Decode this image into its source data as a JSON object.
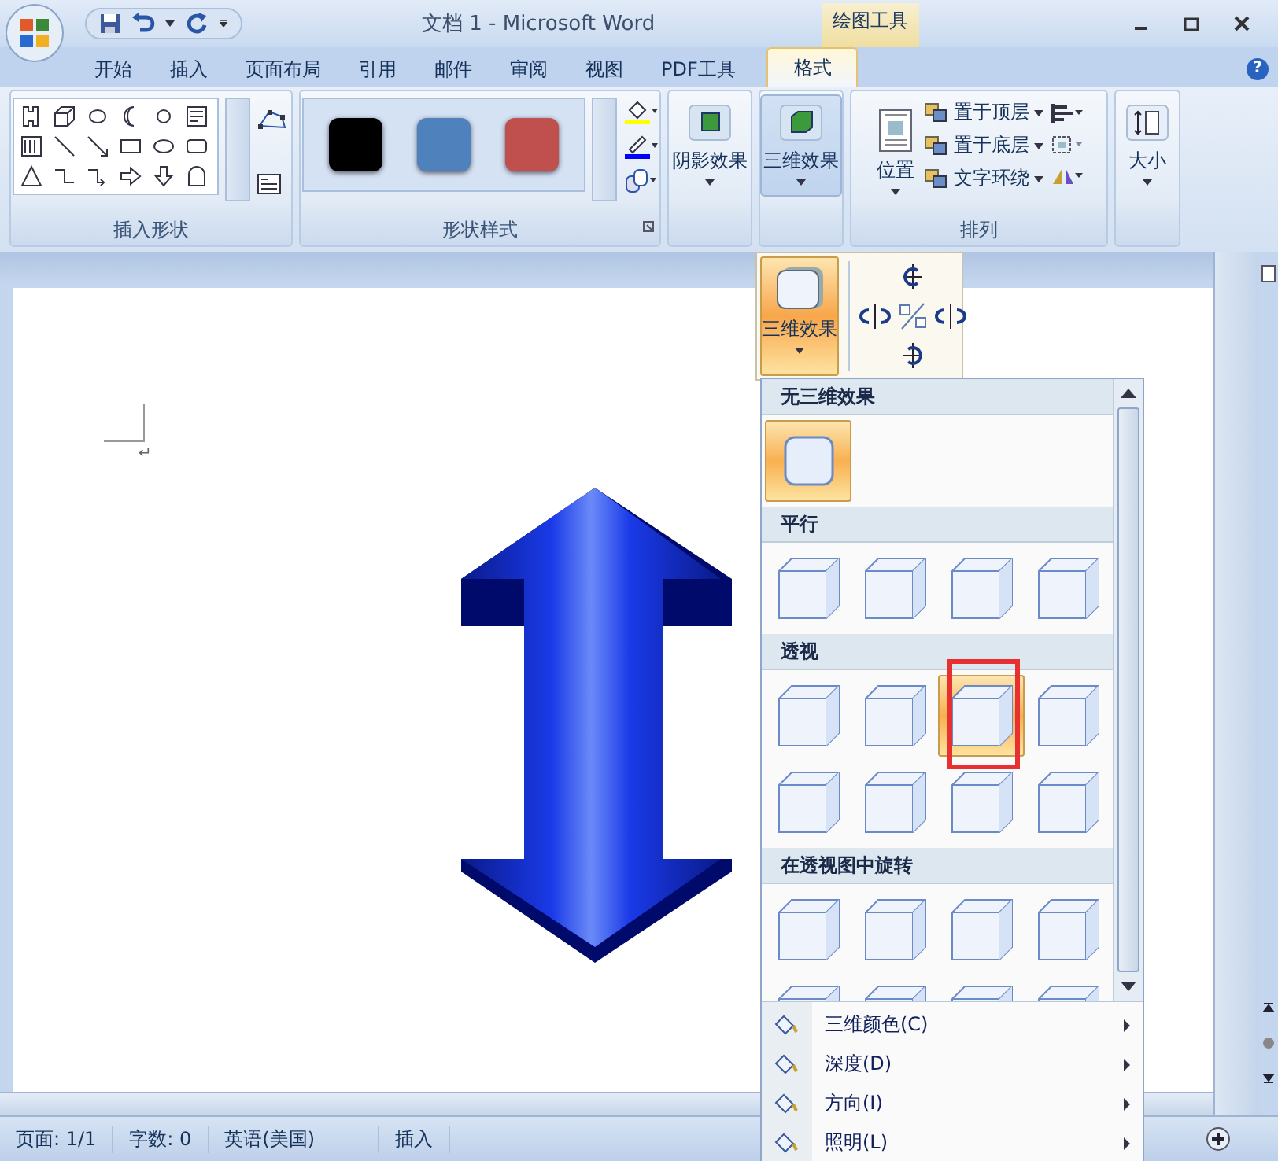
{
  "title_bar": {
    "title": "文档 1 - Microsoft Word",
    "context_tab": "绘图工具"
  },
  "tabs": [
    {
      "label": "开始",
      "selected": false
    },
    {
      "label": "插入",
      "selected": false
    },
    {
      "label": "页面布局",
      "selected": false
    },
    {
      "label": "引用",
      "selected": false
    },
    {
      "label": "邮件",
      "selected": false
    },
    {
      "label": "审阅",
      "selected": false
    },
    {
      "label": "视图",
      "selected": false
    },
    {
      "label": "PDF工具",
      "selected": false
    },
    {
      "label": "格式",
      "selected": true
    }
  ],
  "help": "?",
  "ribbon": {
    "insert_shapes": {
      "label": "插入形状"
    },
    "shape_styles": {
      "label": "形状样式",
      "swatches": [
        {
          "color": "#000000"
        },
        {
          "color": "#4f81bd"
        },
        {
          "color": "#c0504d"
        }
      ]
    },
    "shadow_effects": {
      "label": "阴影效果",
      "pressed": false
    },
    "three_d_effects": {
      "label": "三维效果",
      "pressed": true
    },
    "arrange": {
      "label": "排列",
      "position": "位置",
      "commands": [
        "置于顶层",
        "置于底层",
        "文字环绕"
      ]
    },
    "size": {
      "label": "大小"
    }
  },
  "three_d_flyout": {
    "button": "三维效果"
  },
  "gallery": {
    "sections": [
      {
        "title": "无三维效果",
        "items": [
          {
            "kind": "flat",
            "highlighted": true,
            "marked": false
          }
        ]
      },
      {
        "title": "平行",
        "items": [
          {
            "kind": "cube",
            "highlighted": false,
            "marked": false
          },
          {
            "kind": "cube",
            "highlighted": false,
            "marked": false
          },
          {
            "kind": "cube",
            "highlighted": false,
            "marked": false
          },
          {
            "kind": "cube",
            "highlighted": false,
            "marked": false
          }
        ]
      },
      {
        "title": "透视",
        "items": [
          {
            "kind": "cube",
            "highlighted": false,
            "marked": false
          },
          {
            "kind": "cube",
            "highlighted": false,
            "marked": false
          },
          {
            "kind": "cube",
            "highlighted": true,
            "marked": true
          },
          {
            "kind": "cube",
            "highlighted": false,
            "marked": false
          },
          {
            "kind": "cube",
            "highlighted": false,
            "marked": false
          },
          {
            "kind": "cube",
            "highlighted": false,
            "marked": false
          },
          {
            "kind": "cube",
            "highlighted": false,
            "marked": false
          },
          {
            "kind": "cube",
            "highlighted": false,
            "marked": false
          }
        ]
      },
      {
        "title": "在透视图中旋转",
        "items": [
          {
            "kind": "cube",
            "highlighted": false,
            "marked": false
          },
          {
            "kind": "cube",
            "highlighted": false,
            "marked": false
          },
          {
            "kind": "cube",
            "highlighted": false,
            "marked": false
          },
          {
            "kind": "cube",
            "highlighted": false,
            "marked": false
          },
          {
            "kind": "cube",
            "highlighted": false,
            "marked": false
          },
          {
            "kind": "cube",
            "highlighted": false,
            "marked": false
          },
          {
            "kind": "cube",
            "highlighted": false,
            "marked": false
          },
          {
            "kind": "cube",
            "highlighted": false,
            "marked": false
          }
        ]
      }
    ]
  },
  "menu": [
    {
      "label": "三维颜色(C)"
    },
    {
      "label": "深度(D)"
    },
    {
      "label": "方向(I)"
    },
    {
      "label": "照明(L)"
    }
  ],
  "document": {
    "paragraph_mark": "↵"
  },
  "status_bar": [
    "页面: 1/1",
    "字数: 0",
    "英语(美国)",
    "插入"
  ]
}
